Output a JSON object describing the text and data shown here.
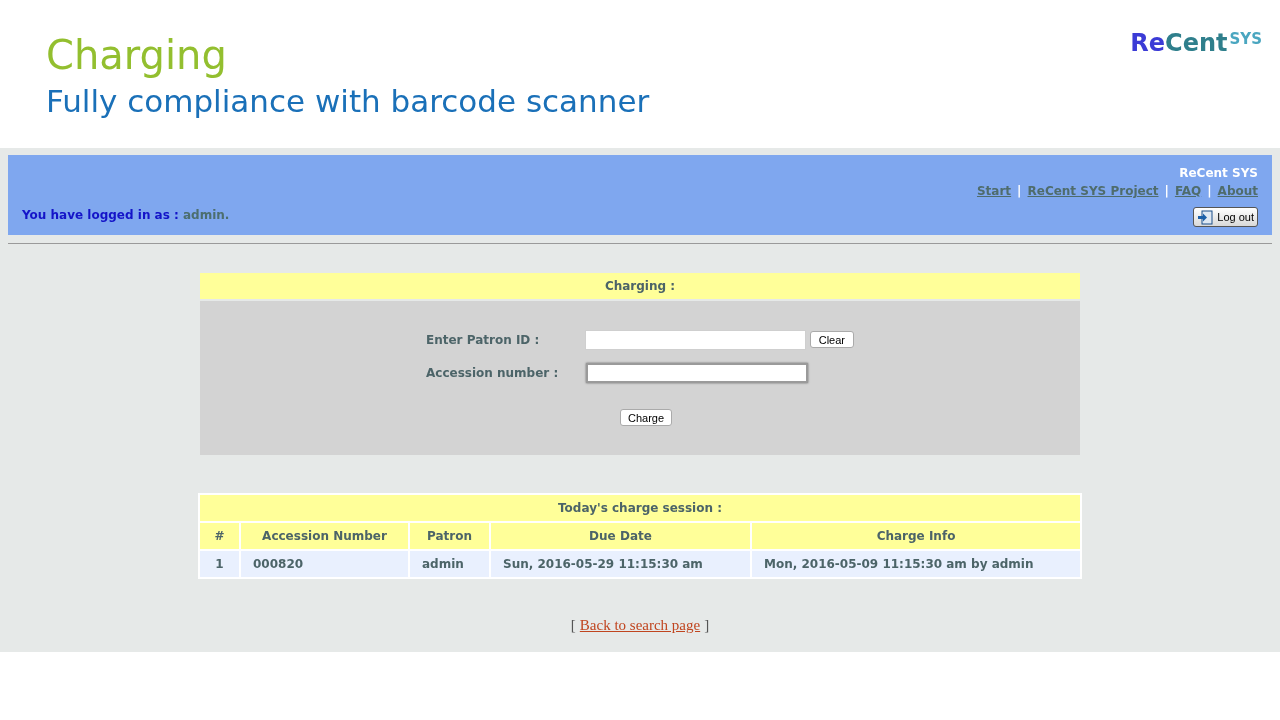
{
  "slide": {
    "title": "Charging",
    "subtitle": "Fully compliance with barcode scanner"
  },
  "logo": {
    "prefix": "Re",
    "main": "Cent",
    "superscript": "SYS"
  },
  "header": {
    "site_name": "ReCent SYS",
    "nav": [
      {
        "kind": "link",
        "text": "Start"
      },
      {
        "kind": "separator",
        "text": "|"
      },
      {
        "kind": "link",
        "text": "ReCent SYS Project"
      },
      {
        "kind": "separator",
        "text": "|"
      },
      {
        "kind": "link",
        "text": "FAQ"
      },
      {
        "kind": "separator",
        "text": "|"
      },
      {
        "kind": "link",
        "text": "About"
      }
    ],
    "login_label": "You have logged in as :",
    "login_user": "admin.",
    "logout": "Log out"
  },
  "charging_form": {
    "title": "Charging :",
    "fields": [
      {
        "label": "Enter Patron ID :",
        "focused": false,
        "button": "Clear"
      },
      {
        "label": "Accession number :",
        "focused": true
      }
    ],
    "submit": "Charge"
  },
  "session_table": {
    "title": "Today's charge session :",
    "columns": [
      "#",
      "Accession Number",
      "Patron",
      "Due Date",
      "Charge Info"
    ],
    "rows": [
      [
        "1",
        "000820",
        "admin",
        "Sun, 2016-05-29 11:15:30 am",
        "Mon, 2016-05-09 11:15:30 am by admin"
      ]
    ]
  },
  "footer": {
    "open": "[",
    "link": "Back to search page",
    "close": "]"
  }
}
